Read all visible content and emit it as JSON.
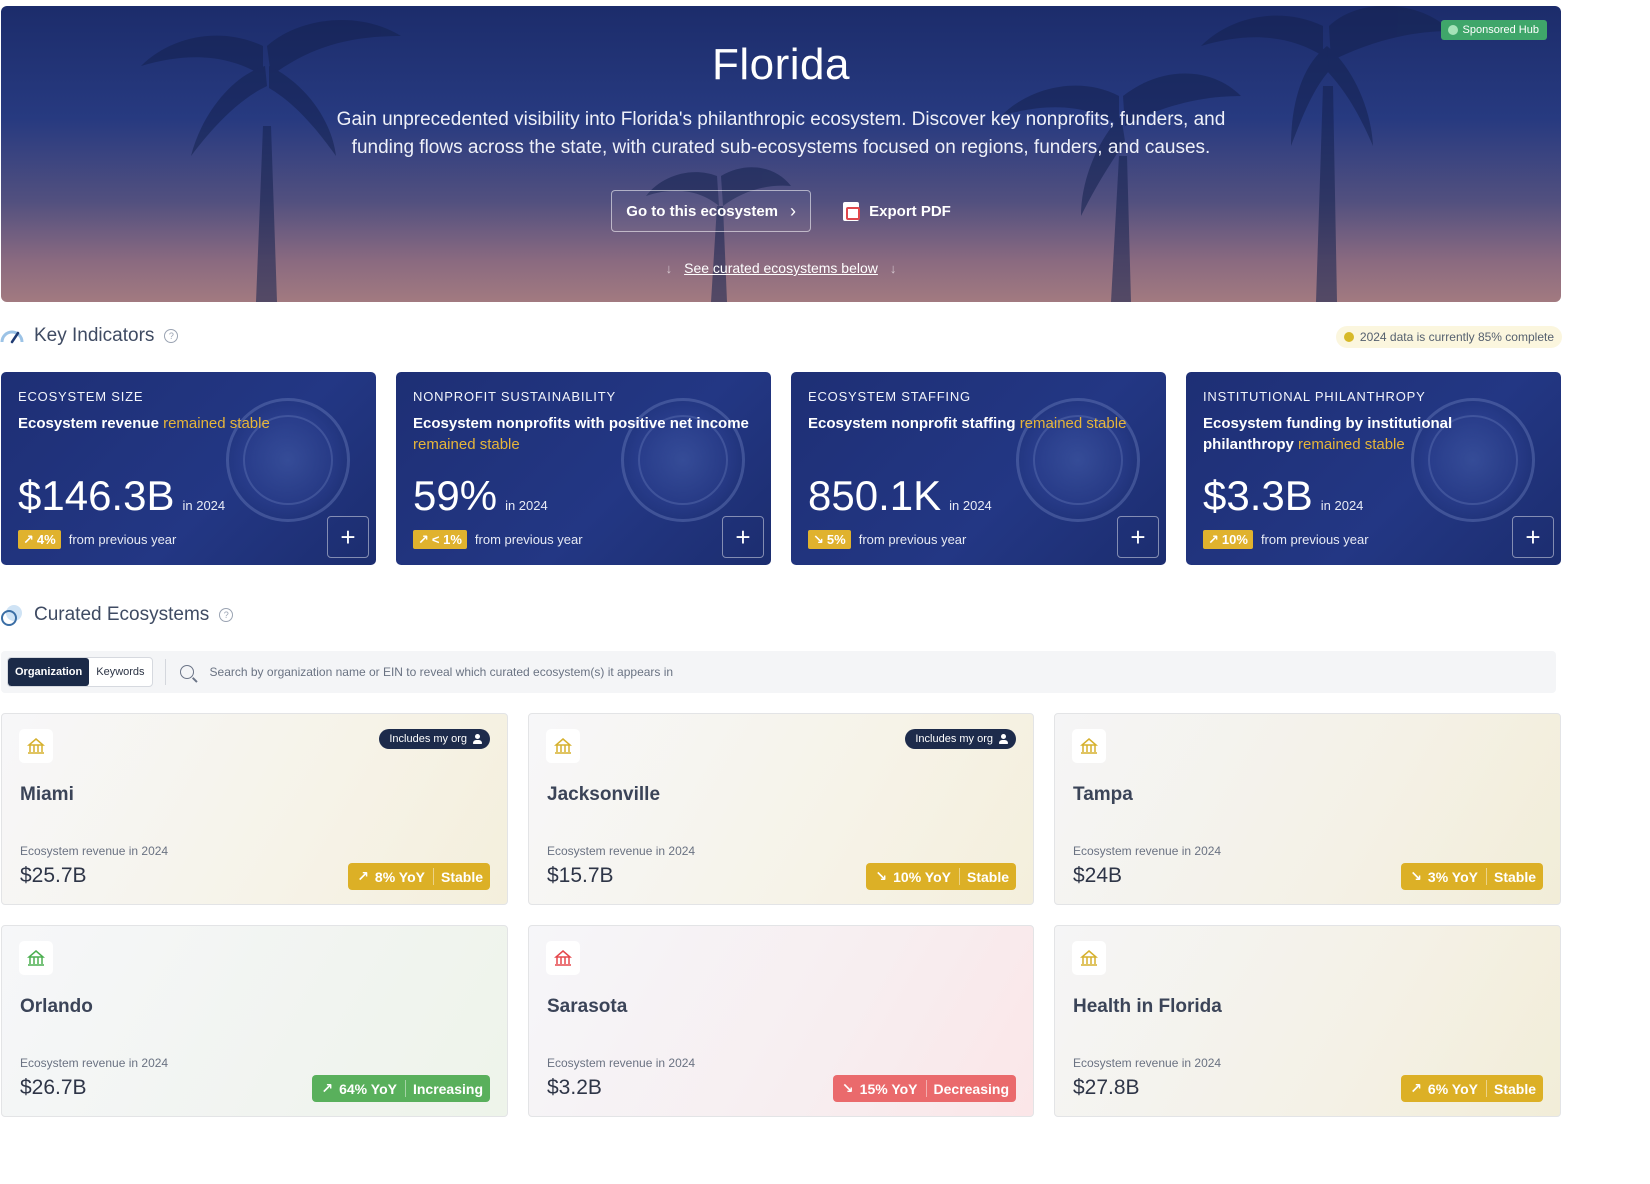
{
  "hero": {
    "badge": "Sponsored Hub",
    "title": "Florida",
    "subtitle": "Gain unprecedented visibility into Florida's philanthropic ecosystem. Discover key nonprofits, funders, and funding flows across the state, with curated sub-ecosystems focused on regions, funders, and causes.",
    "primary_button": "Go to this ecosystem",
    "export_button": "Export PDF",
    "see_link": "See curated ecosystems below"
  },
  "key_indicators": {
    "title": "Key Indicators",
    "data_status": "2024 data is currently 85% complete",
    "cards": [
      {
        "kicker": "ECOSYSTEM SIZE",
        "desc_main": "Ecosystem revenue ",
        "desc_highlight": "remained stable",
        "value": "$146.3B",
        "year": "in 2024",
        "change": "4%",
        "change_arrow": "↗",
        "change_note": "from previous year"
      },
      {
        "kicker": "NONPROFIT SUSTAINABILITY",
        "desc_main": "Ecosystem nonprofits with positive net income ",
        "desc_highlight": "remained stable",
        "value": "59%",
        "year": "in 2024",
        "change": "< 1%",
        "change_arrow": "↗",
        "change_note": "from previous year"
      },
      {
        "kicker": "ECOSYSTEM STAFFING",
        "desc_main": "Ecosystem nonprofit staffing ",
        "desc_highlight": "remained stable",
        "value": "850.1K",
        "year": "in 2024",
        "change": "5%",
        "change_arrow": "↘",
        "change_note": "from previous year"
      },
      {
        "kicker": "INSTITUTIONAL PHILANTHROPY",
        "desc_main": "Ecosystem funding by institutional philanthropy ",
        "desc_highlight": "remained stable",
        "value": "$3.3B",
        "year": "in 2024",
        "change": "10%",
        "change_arrow": "↗",
        "change_note": "from previous year"
      }
    ]
  },
  "curated": {
    "title": "Curated Ecosystems",
    "toggle": [
      "Organization",
      "Keywords"
    ],
    "search_placeholder": "Search by organization name or EIN to reveal which curated ecosystem(s) it appears in",
    "badge_text": "Includes my org",
    "revenue_label": "Ecosystem revenue in 2024",
    "cards": [
      {
        "name": "Miami",
        "value": "$25.7B",
        "yoy": "8% YoY",
        "arrow": "↗",
        "status": "Stable",
        "includes_org": true,
        "theme": "yellow",
        "icon_color": "#d6b12e"
      },
      {
        "name": "Jacksonville",
        "value": "$15.7B",
        "yoy": "10% YoY",
        "arrow": "↘",
        "status": "Stable",
        "includes_org": true,
        "theme": "yellow",
        "icon_color": "#d6b12e"
      },
      {
        "name": "Tampa",
        "value": "$24B",
        "yoy": "3% YoY",
        "arrow": "↘",
        "status": "Stable",
        "includes_org": false,
        "theme": "yellow2",
        "icon_color": "#d6b12e"
      },
      {
        "name": "Orlando",
        "value": "$26.7B",
        "yoy": "64% YoY",
        "arrow": "↗",
        "status": "Increasing",
        "includes_org": false,
        "theme": "green",
        "icon_color": "#4caf50"
      },
      {
        "name": "Sarasota",
        "value": "$3.2B",
        "yoy": "15% YoY",
        "arrow": "↘",
        "status": "Decreasing",
        "includes_org": false,
        "theme": "red",
        "icon_color": "#e5484d"
      },
      {
        "name": "Health in Florida",
        "value": "$27.8B",
        "yoy": "6% YoY",
        "arrow": "↗",
        "status": "Stable",
        "includes_org": false,
        "theme": "yellow2",
        "icon_color": "#d6b12e"
      }
    ]
  }
}
